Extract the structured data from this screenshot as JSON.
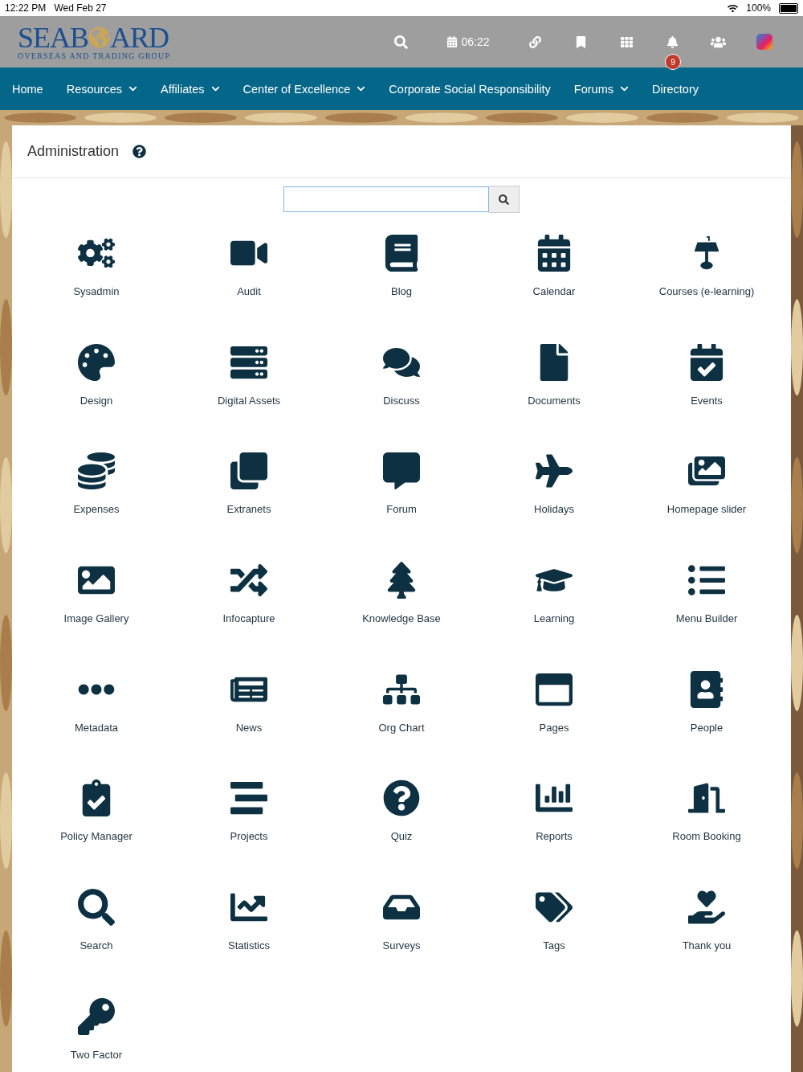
{
  "status_bar": {
    "time": "12:22 PM",
    "date": "Wed Feb 27",
    "battery": "100%"
  },
  "logo": {
    "text_left": "SEAB",
    "text_right": "ARD",
    "tagline": "OVERSEAS AND TRADING GROUP"
  },
  "toolbar": {
    "clock": "06:22",
    "notification_count": "9"
  },
  "nav": [
    {
      "label": "Home",
      "has_menu": false
    },
    {
      "label": "Resources",
      "has_menu": true
    },
    {
      "label": "Affiliates",
      "has_menu": true
    },
    {
      "label": "Center of Excellence",
      "has_menu": true
    },
    {
      "label": "Corporate Social Responsibility",
      "has_menu": false
    },
    {
      "label": "Forums",
      "has_menu": true
    },
    {
      "label": "Directory",
      "has_menu": false
    }
  ],
  "panel": {
    "title": "Administration"
  },
  "modules": [
    {
      "label": "Sysadmin"
    },
    {
      "label": "Audit"
    },
    {
      "label": "Blog"
    },
    {
      "label": "Calendar"
    },
    {
      "label": "Courses (e-learning)"
    },
    {
      "label": "Design"
    },
    {
      "label": "Digital Assets"
    },
    {
      "label": "Discuss"
    },
    {
      "label": "Documents"
    },
    {
      "label": "Events"
    },
    {
      "label": "Expenses"
    },
    {
      "label": "Extranets"
    },
    {
      "label": "Forum"
    },
    {
      "label": "Holidays"
    },
    {
      "label": "Homepage slider"
    },
    {
      "label": "Image Gallery"
    },
    {
      "label": "Infocapture"
    },
    {
      "label": "Knowledge Base"
    },
    {
      "label": "Learning"
    },
    {
      "label": "Menu Builder"
    },
    {
      "label": "Metadata"
    },
    {
      "label": "News"
    },
    {
      "label": "Org Chart"
    },
    {
      "label": "Pages"
    },
    {
      "label": "People"
    },
    {
      "label": "Policy Manager"
    },
    {
      "label": "Projects"
    },
    {
      "label": "Quiz"
    },
    {
      "label": "Reports"
    },
    {
      "label": "Room Booking"
    },
    {
      "label": "Search"
    },
    {
      "label": "Statistics"
    },
    {
      "label": "Surveys"
    },
    {
      "label": "Tags"
    },
    {
      "label": "Thank you"
    },
    {
      "label": "Two Factor"
    }
  ]
}
